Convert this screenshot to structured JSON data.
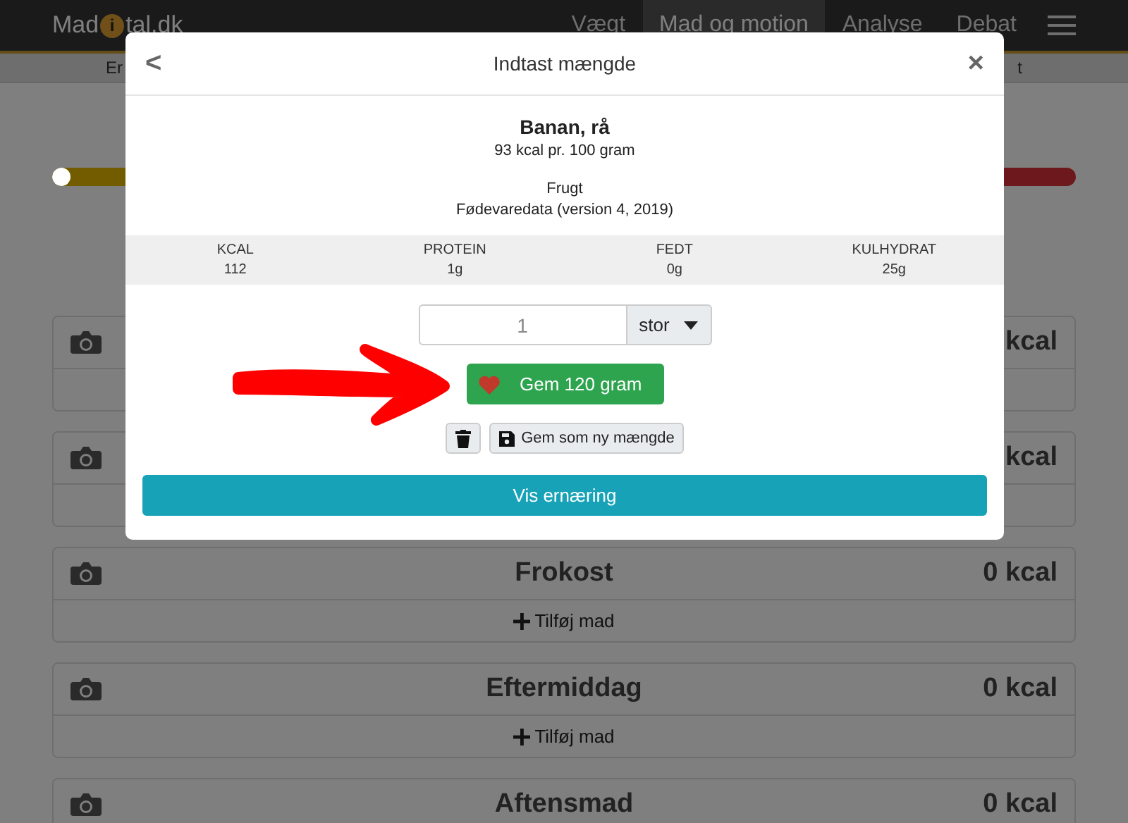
{
  "navbar": {
    "logo": {
      "before": "Mad",
      "badge": "i",
      "after": "tal.dk"
    },
    "items": [
      {
        "label": "Vægt",
        "selected": false
      },
      {
        "label": "Mad og motion",
        "selected": true
      },
      {
        "label": "Analyse",
        "selected": false
      },
      {
        "label": "Debat",
        "selected": false
      }
    ],
    "subnav": [
      "Er",
      "t"
    ]
  },
  "meals": [
    {
      "kcal": "kcal"
    },
    {
      "kcal": "kcal"
    },
    {
      "title": "Frokost",
      "kcal": "0 kcal",
      "add_label": "Tilføj mad"
    },
    {
      "title": "Eftermiddag",
      "kcal": "0 kcal",
      "add_label": "Tilføj mad"
    },
    {
      "title": "Aftensmad",
      "kcal": "0 kcal"
    }
  ],
  "modal": {
    "back": "<",
    "title": "Indtast mængde",
    "close": "×",
    "food": {
      "name": "Banan, rå",
      "energy": "93 kcal pr. 100 gram",
      "category": "Frugt",
      "source": "Fødevaredata (version 4, 2019)"
    },
    "nutrients": [
      {
        "label": "KCAL",
        "value": "112"
      },
      {
        "label": "PROTEIN",
        "value": "1g"
      },
      {
        "label": "FEDT",
        "value": "0g"
      },
      {
        "label": "KULHYDRAT",
        "value": "25g"
      }
    ],
    "amount": {
      "placeholder": "1",
      "unit": "stor"
    },
    "save_button": "Gem 120 gram",
    "save_new_button": "Gem som ny mængde",
    "nutrition_button": "Vis ernæring"
  }
}
